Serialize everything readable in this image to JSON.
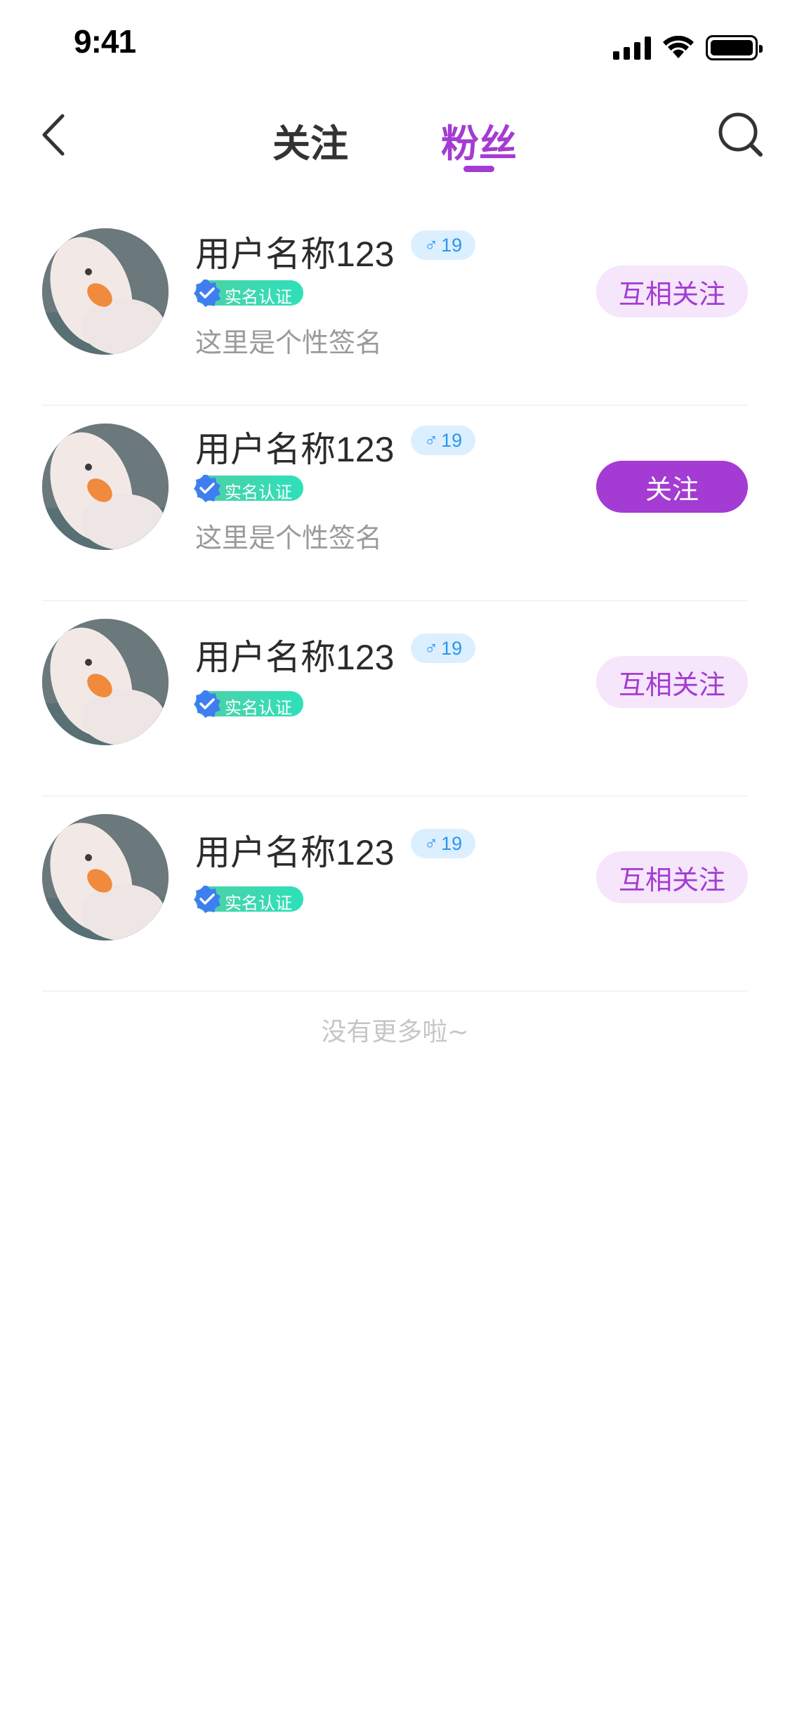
{
  "status_bar": {
    "time": "9:41"
  },
  "nav": {
    "tabs": [
      {
        "label": "关注",
        "active": false
      },
      {
        "label": "粉丝",
        "active": true
      }
    ],
    "accent_color": "#a43bd3"
  },
  "users": [
    {
      "name": "用户名称123",
      "gender_symbol": "♂",
      "age": "19",
      "verified_label": "实名认证",
      "signature": "这里是个性签名",
      "action_label": "互相关注",
      "action_style": "mutual"
    },
    {
      "name": "用户名称123",
      "gender_symbol": "♂",
      "age": "19",
      "verified_label": "实名认证",
      "signature": "这里是个性签名",
      "action_label": "关注",
      "action_style": "follow"
    },
    {
      "name": "用户名称123",
      "gender_symbol": "♂",
      "age": "19",
      "verified_label": "实名认证",
      "signature": "",
      "action_label": "互相关注",
      "action_style": "mutual"
    },
    {
      "name": "用户名称123",
      "gender_symbol": "♂",
      "age": "19",
      "verified_label": "实名认证",
      "signature": "",
      "action_label": "互相关注",
      "action_style": "mutual"
    }
  ],
  "list_end_text": "没有更多啦~",
  "icons": {
    "back": "chevron-left-icon",
    "search": "search-icon",
    "verified": "verified-badge-icon",
    "gender": "male-icon"
  }
}
